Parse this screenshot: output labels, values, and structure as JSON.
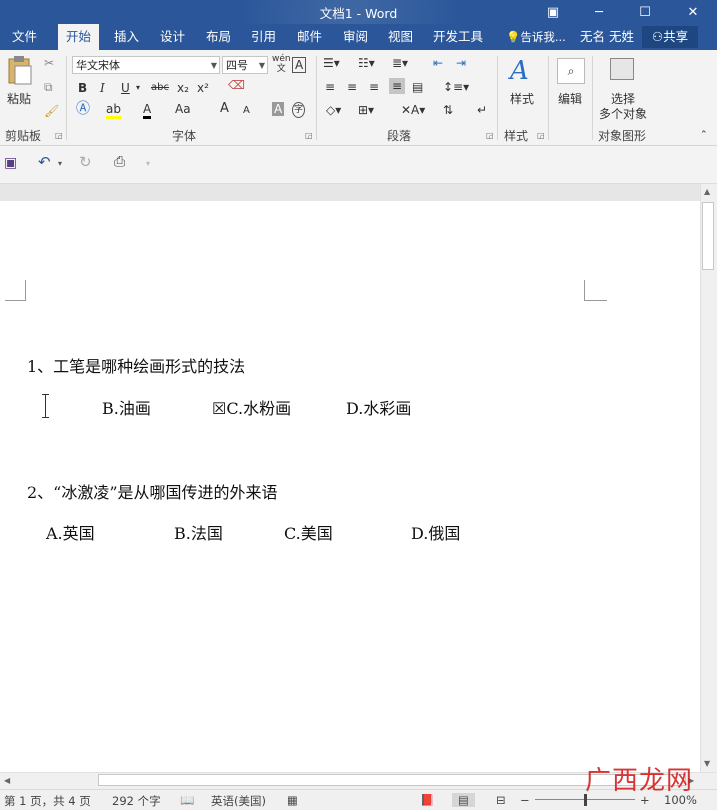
{
  "window": {
    "title": "文档1 - Word",
    "ribbon_display_icon": "▣",
    "minimize_icon": "─",
    "maximize_icon": "☐",
    "close_icon": "✕"
  },
  "tabs": {
    "file": "文件",
    "home": "开始",
    "insert": "插入",
    "design": "设计",
    "layout": "布局",
    "references": "引用",
    "mailings": "邮件",
    "review": "审阅",
    "view": "视图",
    "developer": "开发工具",
    "tell_me": "告诉我...",
    "user": "无名 无姓",
    "share": "共享"
  },
  "ribbon": {
    "clipboard": {
      "paste": "粘贴",
      "label": "剪贴板"
    },
    "font": {
      "font_name": "华文宋体",
      "font_size": "四号",
      "label": "字体",
      "bold": "B",
      "italic": "I",
      "underline": "U",
      "strike": "abc",
      "subscript": "x₂",
      "superscript": "x²",
      "grow": "A",
      "shrink": "A",
      "change_case": "Aa",
      "clear": "A",
      "pinyin": "wén",
      "border_char": "A",
      "enclose": "字"
    },
    "paragraph": {
      "label": "段落"
    },
    "styles": {
      "button": "样式",
      "label": "样式"
    },
    "editing": {
      "button": "编辑"
    },
    "select": {
      "button_line1": "选择",
      "button_line2": "多个对象",
      "label": "对象图形"
    }
  },
  "qat": {
    "save_icon": "save",
    "undo_icon": "undo",
    "redo_icon": "redo",
    "preview_icon": "print-preview"
  },
  "document": {
    "q1": "1、工笔是哪种绘画形式的技法",
    "q1_options": [
      "B.油画",
      "☒C.水粉画",
      "D.水彩画"
    ],
    "q2": "2、“冰激凌”是从哪国传进的外来语",
    "q2_options": [
      "A.英国",
      "B.法国",
      "C.美国",
      "D.俄国"
    ]
  },
  "status": {
    "page": "第 1 页，共 4 页",
    "words": "292 个字",
    "language": "英语(美国)",
    "zoom": "100%"
  },
  "watermark": "广西龙网"
}
